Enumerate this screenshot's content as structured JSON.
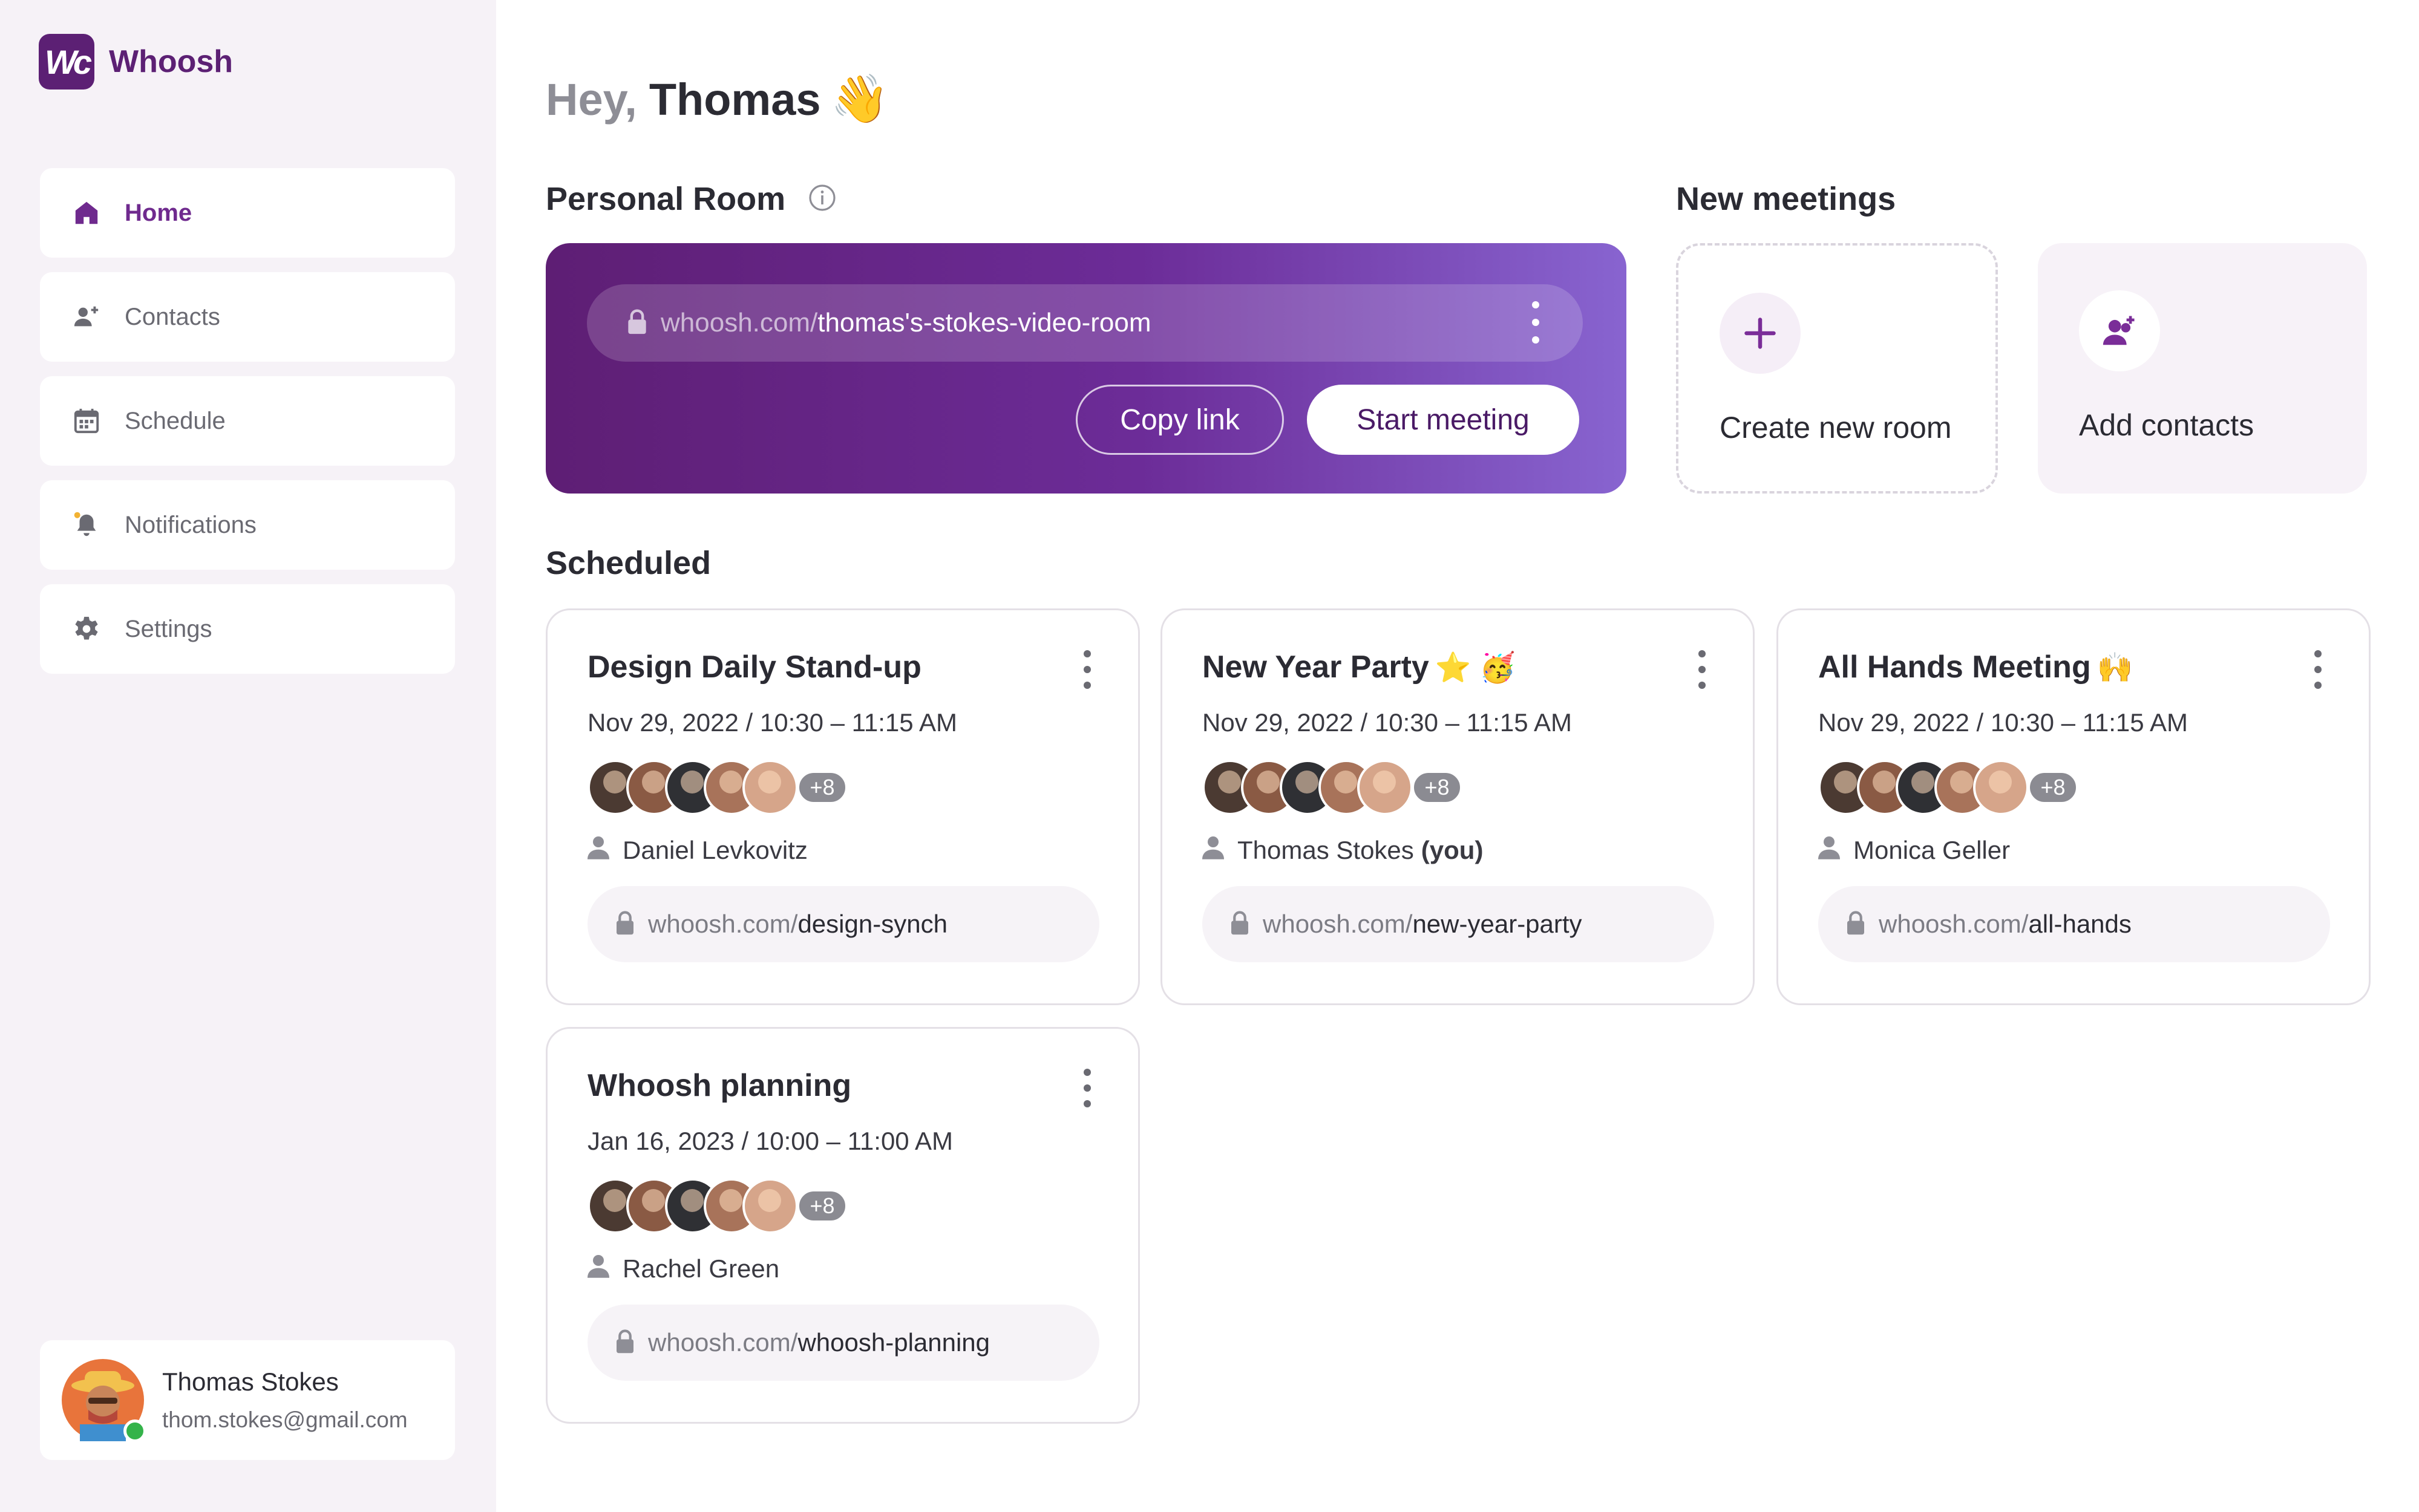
{
  "app": {
    "name": "Whoosh",
    "logo_mark": "Wc"
  },
  "sidebar": {
    "items": [
      {
        "label": "Home",
        "icon": "home-icon",
        "active": true
      },
      {
        "label": "Contacts",
        "icon": "contacts-icon"
      },
      {
        "label": "Schedule",
        "icon": "calendar-icon"
      },
      {
        "label": "Notifications",
        "icon": "bell-icon"
      },
      {
        "label": "Settings",
        "icon": "gear-icon"
      }
    ],
    "user": {
      "name": "Thomas Stokes",
      "email": "thom.stokes@gmail.com",
      "status": "online"
    }
  },
  "greeting": {
    "prefix": "Hey,",
    "name": "Thomas",
    "emoji": "👋"
  },
  "personal_room": {
    "title": "Personal Room",
    "url_domain": "whoosh.com/",
    "url_path": "thomas's-stokes-video-room",
    "copy_label": "Copy link",
    "start_label": "Start meeting"
  },
  "new_meetings": {
    "title": "New meetings",
    "create_label": "Create new room",
    "add_label": "Add contacts"
  },
  "scheduled": {
    "title": "Scheduled",
    "meetings": [
      {
        "title": "Design Daily Stand-up",
        "emoji": "",
        "date": "Nov 29, 2022 / 10:30 – 11:15 AM",
        "more": "+8",
        "host": "Daniel Levkovitz",
        "host_suffix": "",
        "link_domain": "whoosh.com/",
        "link_path": "design-synch"
      },
      {
        "title": "New Year Party",
        "emoji": "⭐ 🥳",
        "date": "Nov 29, 2022 / 10:30 – 11:15 AM",
        "more": "+8",
        "host": "Thomas Stokes",
        "host_suffix": "(you)",
        "link_domain": "whoosh.com/",
        "link_path": "new-year-party"
      },
      {
        "title": "All Hands Meeting",
        "emoji": "🙌",
        "date": "Nov 29, 2022 / 10:30 – 11:15 AM",
        "more": "+8",
        "host": "Monica Geller",
        "host_suffix": "",
        "link_domain": "whoosh.com/",
        "link_path": "all-hands"
      },
      {
        "title": "Whoosh planning",
        "emoji": "",
        "date": "Jan 16, 2023 / 10:00 – 11:00 AM",
        "more": "+8",
        "host": "Rachel Green",
        "host_suffix": "",
        "link_domain": "whoosh.com/",
        "link_path": "whoosh-planning"
      }
    ]
  },
  "colors": {
    "brand": "#5c2074",
    "accent": "#6f2a8e",
    "banner_start": "#5e1e74",
    "banner_end": "#8864d0",
    "online": "#34b34a"
  }
}
